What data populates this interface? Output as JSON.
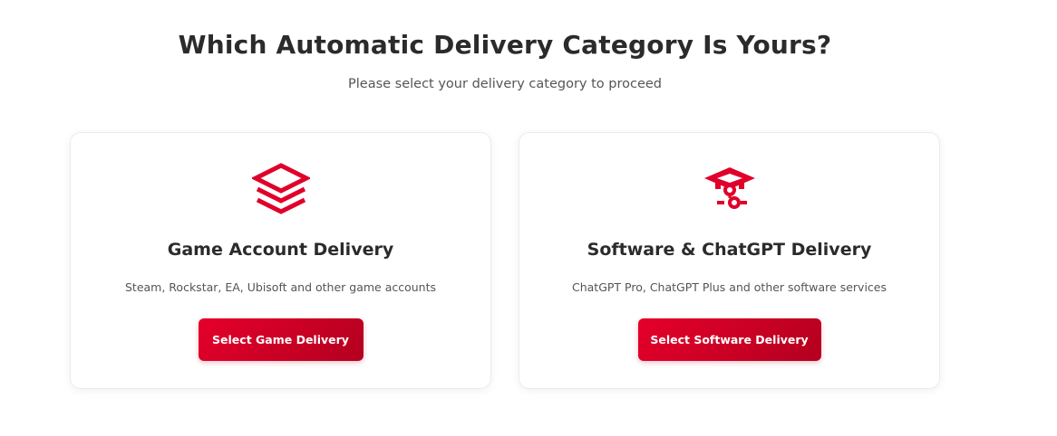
{
  "header": {
    "title": "Which Automatic Delivery Category Is Yours?",
    "subtitle": "Please select your delivery category to proceed"
  },
  "cards": [
    {
      "icon": "layers-icon",
      "title": "Game Account Delivery",
      "description": "Steam, Rockstar, EA, Ubisoft and other game accounts",
      "button_label": "Select Game Delivery"
    },
    {
      "icon": "graduation-cap-icon",
      "title": "Software & ChatGPT Delivery",
      "description": "ChatGPT Pro, ChatGPT Plus and other software services",
      "button_label": "Select Software Delivery"
    }
  ],
  "colors": {
    "accent": "#e0002a",
    "accent_dark": "#b3001f",
    "text": "#2b2b2b",
    "muted": "#555555"
  }
}
